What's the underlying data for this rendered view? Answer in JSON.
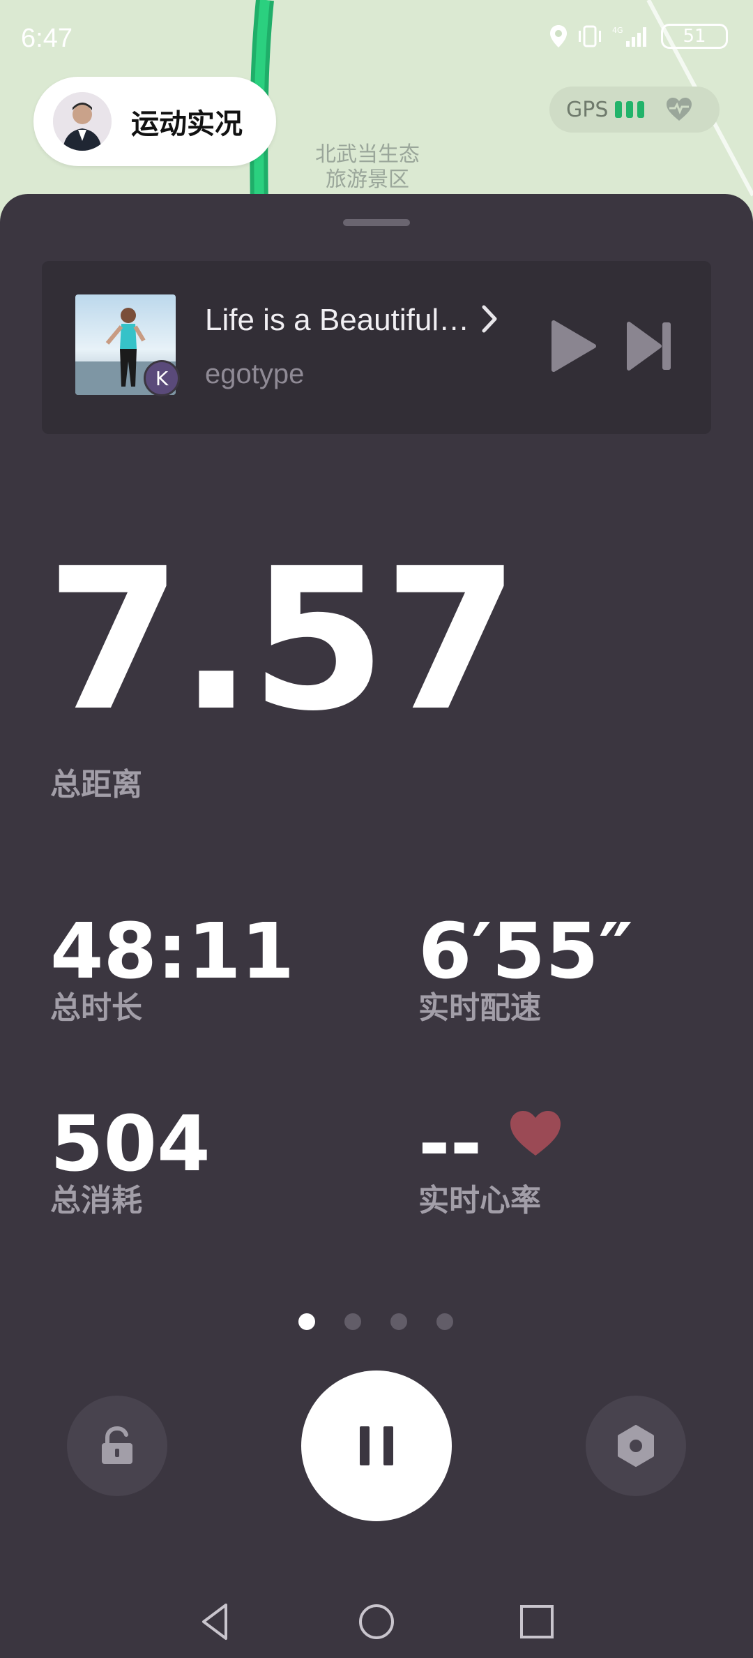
{
  "status_bar": {
    "time": "6:47",
    "battery": "51",
    "network": "4G"
  },
  "header": {
    "live_title": "运动实况",
    "gps_label": "GPS",
    "map_place_label_line1": "北武当生态",
    "map_place_label_line2": "旅游景区"
  },
  "music": {
    "song_title": "Life is a Beautiful Life",
    "artist": "egotype",
    "badge": "K"
  },
  "main": {
    "distance_value": "7.57",
    "distance_label": "总距离"
  },
  "stats": [
    {
      "value": "48:11",
      "label": "总时长"
    },
    {
      "value": "6′55″",
      "label": "实时配速"
    },
    {
      "value": "504",
      "label": "总消耗"
    },
    {
      "value": "--",
      "label": "实时心率"
    }
  ],
  "pager": {
    "count": 4,
    "active": 0
  },
  "icons": {
    "location": "location-icon",
    "vibrate": "vibrate-icon",
    "signal": "signal-icon",
    "heart_monitor": "heart-monitor-icon",
    "arrow": "chevron-right-icon",
    "play": "play-icon",
    "next": "skip-next-icon",
    "heart": "heart-icon",
    "lock": "unlock-icon",
    "pause": "pause-icon",
    "settings": "settings-icon",
    "back": "back-icon",
    "home": "home-icon",
    "recents": "recents-icon"
  },
  "colors": {
    "sheet_bg": "#3b3640",
    "gps_green": "#22b36a",
    "heart_red": "#9b4a55",
    "route_green": "#2bb673"
  }
}
